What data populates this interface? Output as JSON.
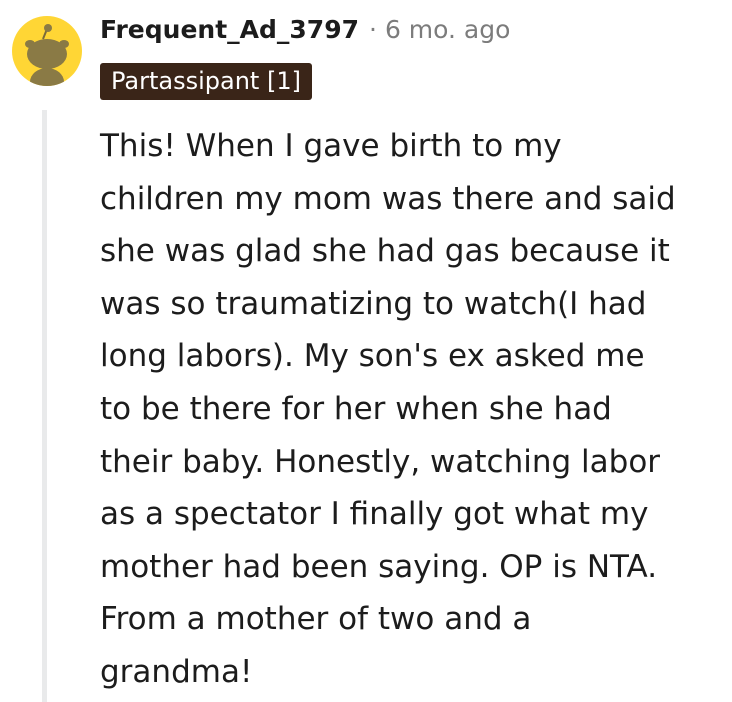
{
  "comment": {
    "author": "Frequent_Ad_3797",
    "separator": "·",
    "timestamp": "6 mo. ago",
    "flair": "Partassipant [1]",
    "body_lines": [
      "This! When I gave birth to my",
      "children my mom was there and said",
      "she was glad she had gas because it",
      "was so traumatizing to watch(I had",
      "long labors). My son's ex asked me",
      "to be there for her when she had",
      "their baby. Honestly, watching labor",
      "as a spectator I finally got what my",
      "mother had been saying. OP is NTA.",
      "From a mother of two and a",
      "grandma!"
    ]
  },
  "avatar": {
    "icon": "snoo-avatar-icon",
    "background_color": "#ffd635"
  },
  "colors": {
    "flair_background": "#3a2518",
    "thread_line": "#e9eaeb",
    "meta_text": "#7c7c7c"
  }
}
